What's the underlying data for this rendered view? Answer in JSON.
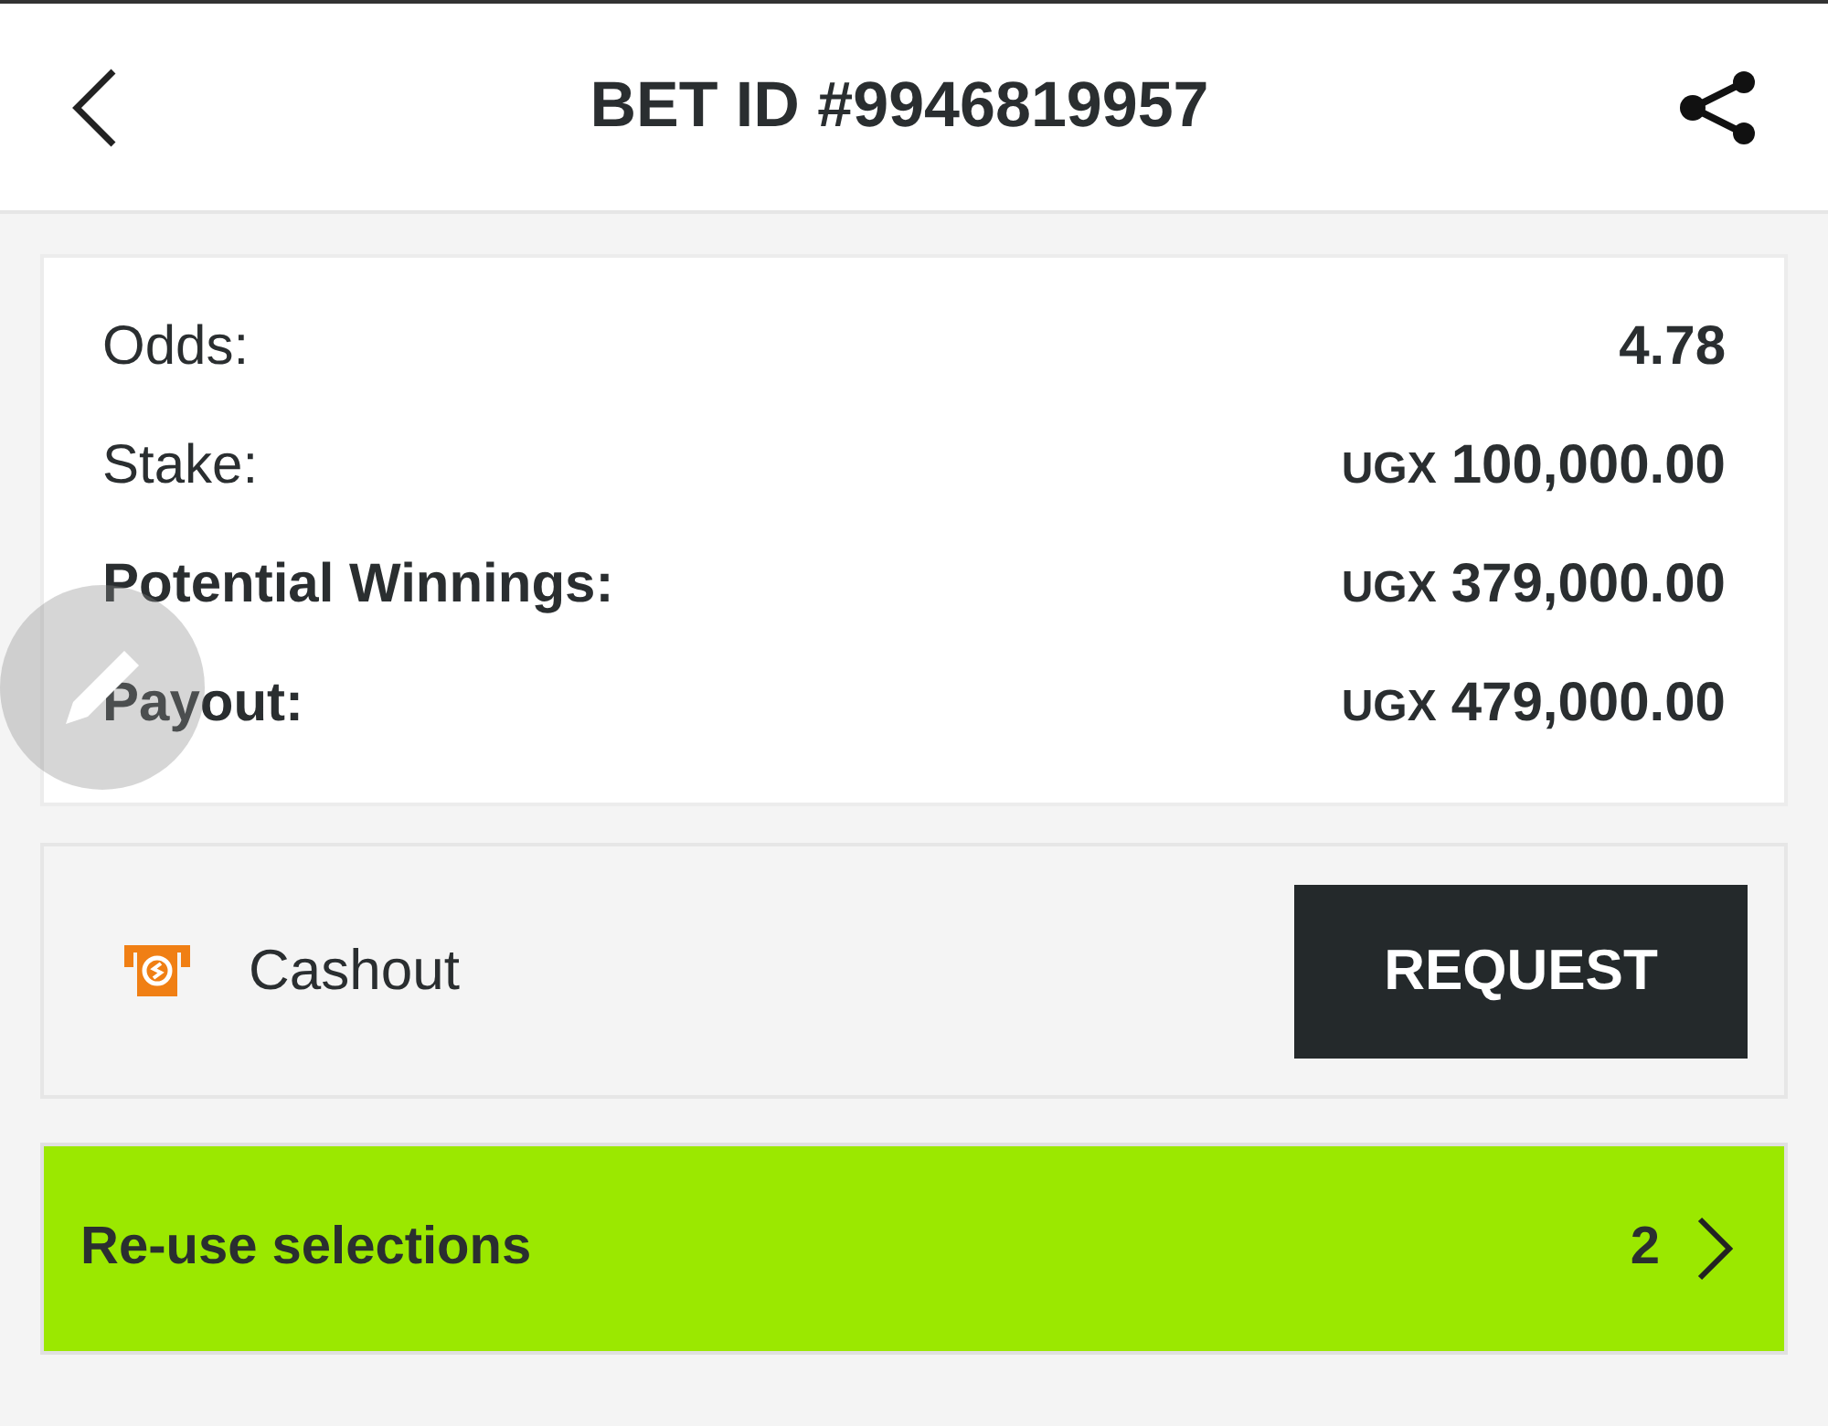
{
  "header": {
    "title": "BET ID #9946819957"
  },
  "summary": [
    {
      "label": "Odds:",
      "emphasis": false,
      "value": "4.78"
    },
    {
      "label": "Stake:",
      "emphasis": false,
      "currency": "UGX",
      "value": "100,000.00"
    },
    {
      "label": "Potential Winnings:",
      "emphasis": true,
      "currency": "UGX",
      "value": "379,000.00"
    },
    {
      "label": "Payout:",
      "emphasis": true,
      "currency": "UGX",
      "value": "479,000.00"
    }
  ],
  "cashout": {
    "label": "Cashout",
    "button": "REQUEST"
  },
  "reuse": {
    "label": "Re-use selections",
    "count": "2"
  }
}
